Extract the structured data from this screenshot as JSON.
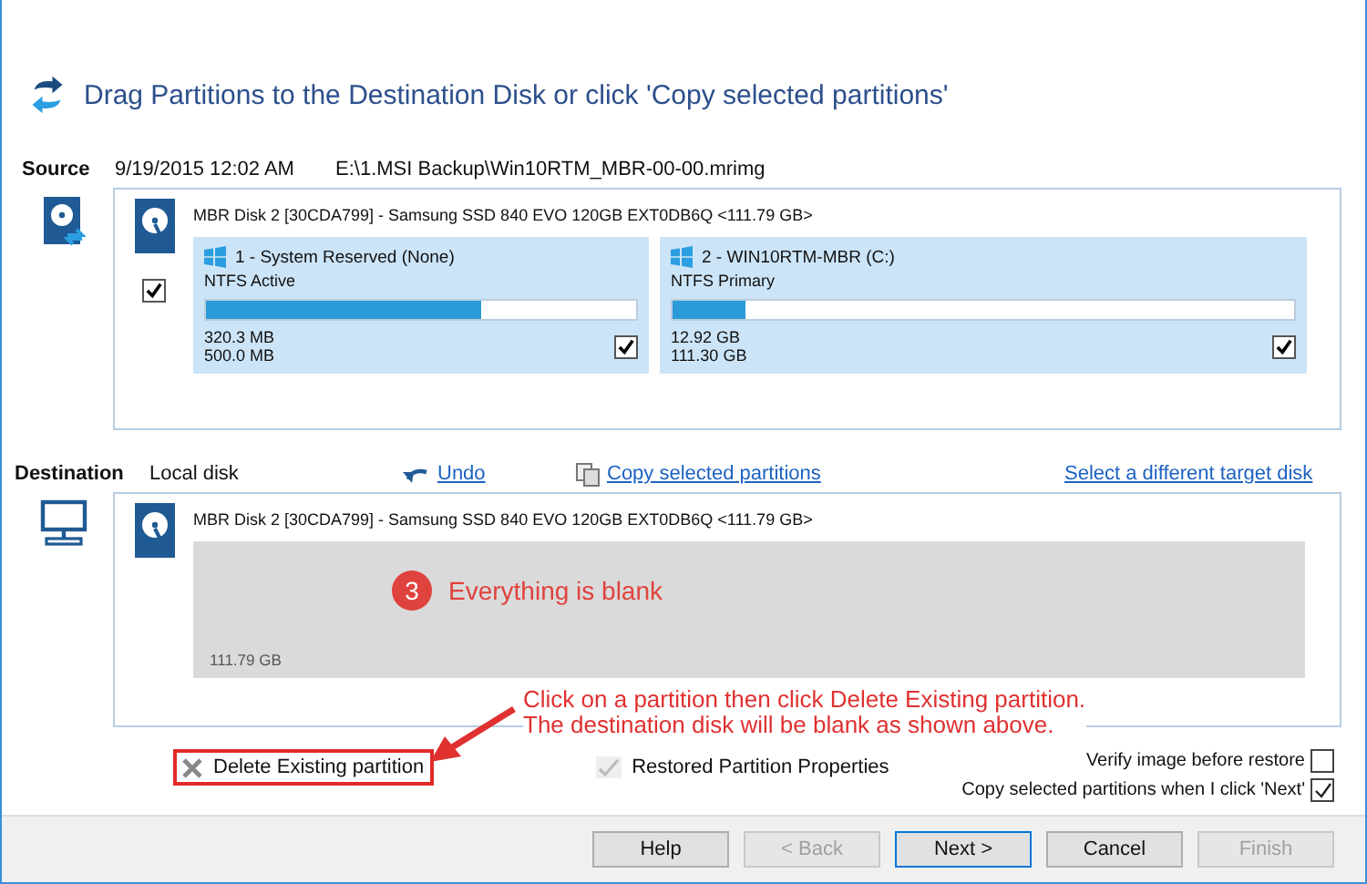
{
  "header": {
    "title": "Drag Partitions to the Destination Disk or click 'Copy selected partitions'"
  },
  "source": {
    "label": "Source",
    "date": "9/19/2015 12:02 AM",
    "path": "E:\\1.MSI Backup\\Win10RTM_MBR-00-00.mrimg",
    "disk": {
      "title": "MBR Disk 2 [30CDA799] - Samsung SSD 840 EVO 120GB EXT0DB6Q  <111.79 GB>",
      "checked": true,
      "partitions": [
        {
          "name": "1 - System Reserved (None)",
          "type": "NTFS Active",
          "level": 0.64,
          "used": "320.3 MB",
          "total": "500.0 MB",
          "checked": true
        },
        {
          "name": "2 - WIN10RTM-MBR (C:)",
          "type": "NTFS Primary",
          "level": 0.116,
          "used": "12.92 GB",
          "total": "111.30 GB",
          "checked": true
        }
      ]
    }
  },
  "destination": {
    "label": "Destination",
    "disk_label": "Local disk",
    "undo": "Undo",
    "copy": "Copy selected partitions",
    "select": "Select a different target disk",
    "disk": {
      "title": "MBR Disk 2 [30CDA799] - Samsung SSD 840 EVO 120GB EXT0DB6Q  <111.79 GB>",
      "size": "111.79 GB"
    },
    "annotation": {
      "number": "3",
      "text": "Everything is blank"
    }
  },
  "note": [
    "Click on a partition then click Delete Existing partition.",
    "The destination disk will be blank as shown above."
  ],
  "options": {
    "delete": {
      "label": "Delete Existing partition",
      "highlighted": true
    },
    "restored": {
      "label": "Restored Partition Properties"
    },
    "checks": [
      {
        "label": "Verify image before restore",
        "checked": false
      },
      {
        "label": "Copy selected partitions when I click 'Next'",
        "checked": true
      }
    ]
  },
  "buttons": [
    {
      "label": "Help",
      "disabled": false,
      "default": false
    },
    {
      "label": "< Back",
      "disabled": true,
      "default": false
    },
    {
      "label": "Next >",
      "disabled": false,
      "default": true
    },
    {
      "label": "Cancel",
      "disabled": false,
      "default": false
    },
    {
      "label": "Finish",
      "disabled": true,
      "default": false
    }
  ]
}
